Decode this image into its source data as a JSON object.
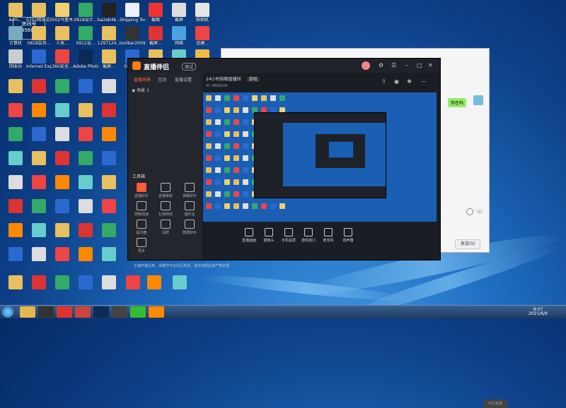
{
  "desktop": {
    "overlay_badge": {
      "line1": "房间号",
      "line2": "9856024"
    },
    "icons": [
      {
        "label": "Adm..."
      },
      {
        "label": "0702相亲文..."
      },
      {
        "label": "0502乌鲁木..."
      },
      {
        "label": "0818设计..."
      },
      {
        "label": "ba2eb4b..."
      },
      {
        "label": "Shipping Tool"
      },
      {
        "label": "截图"
      },
      {
        "label": "截屏"
      },
      {
        "label": "照相机"
      },
      {
        "label": "计算机"
      },
      {
        "label": "0818会员..."
      },
      {
        "label": "人体..."
      },
      {
        "label": "0912设..."
      },
      {
        "label": "1297124..."
      },
      {
        "label": "toolbar2009"
      },
      {
        "label": "截屏..."
      },
      {
        "label": "网络"
      },
      {
        "label": "迅捷..."
      },
      {
        "label": "回收站"
      },
      {
        "label": "Internet Explorer"
      },
      {
        "label": "360安全..."
      },
      {
        "label": "Adobe Photoshop"
      },
      {
        "label": "截屏..."
      },
      {
        "label": "Outlook"
      },
      {
        "label": "截图"
      },
      {
        "label": "QQ音乐"
      },
      {
        "label": "Google Chrome"
      }
    ]
  },
  "taskbar": {
    "tray_time": "9:07",
    "tray_date": "2021/6/9"
  },
  "back_window": {
    "chat_bubble": "你在吗",
    "send_button": "发送(S)"
  },
  "app": {
    "brand": "直播伴侣",
    "beta_badge": "测试",
    "tabs": [
      {
        "label": "直播场景",
        "active": true
      },
      {
        "label": "互动"
      },
      {
        "label": "直播设置"
      }
    ],
    "scene_label": "场景 1",
    "tools_title": "工具箱",
    "tools": [
      {
        "label": "直播助手",
        "on": true
      },
      {
        "label": "直播美颜"
      },
      {
        "label": "弹幕助手"
      },
      {
        "label": "网络测速"
      },
      {
        "label": "礼物特效"
      },
      {
        "label": "福利宝"
      },
      {
        "label": "提词器"
      },
      {
        "label": "清屏"
      },
      {
        "label": "数据助手"
      },
      {
        "label": "更多"
      }
    ],
    "notice": "主播开播注意，请遵守平台社区规范，违法违规必将严肃处理",
    "room_title": "24小时陪聊直播间",
    "room_tag": "游戏",
    "room_sub": "ID: 9856024",
    "bottom_actions": [
      {
        "label": "直播画面"
      },
      {
        "label": "摄像头"
      },
      {
        "label": "手机投屏"
      },
      {
        "label": "游戏窗口"
      },
      {
        "label": "麦克风"
      },
      {
        "label": "扬声器"
      }
    ],
    "go_live": "开始直播",
    "accent": "#ff6a3d"
  }
}
